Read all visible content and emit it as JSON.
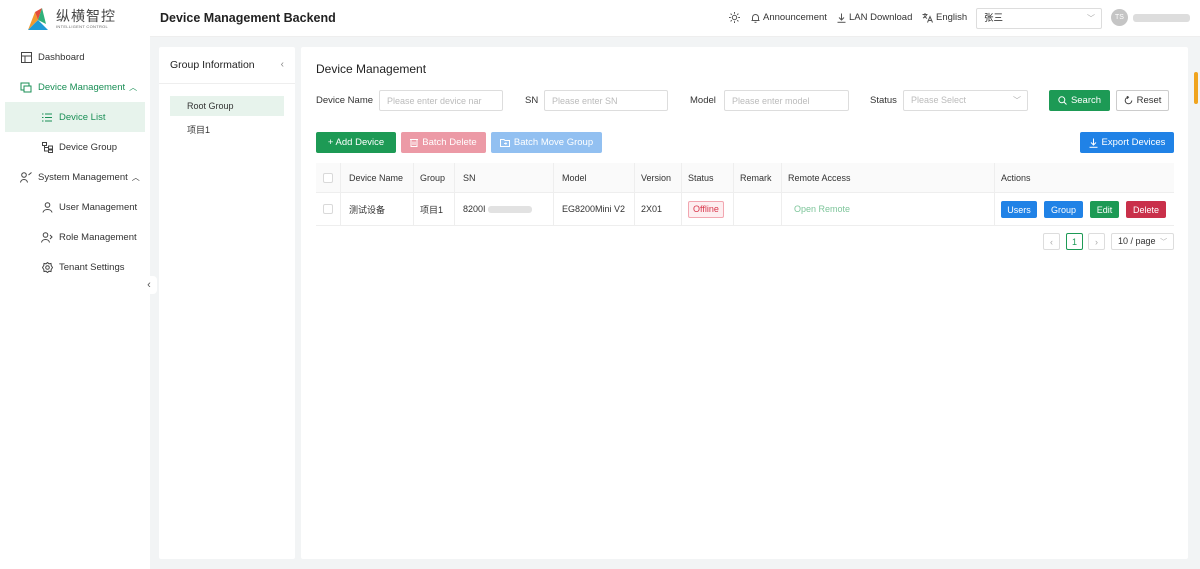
{
  "brand": {
    "name_cn": "纵横智控",
    "name_en": "INTELLIGENT CONTROL",
    "colors": {
      "primary": "#1d9a55",
      "blue": "#2082e6",
      "danger": "#d8364b"
    }
  },
  "header": {
    "title": "Device Management Backend",
    "theme_icon": "sun-icon",
    "announcement": "Announcement",
    "lan_download": "LAN Download",
    "language": "English",
    "tenant_user": "张三",
    "avatar_initials": "TS"
  },
  "sidebar": {
    "items": [
      {
        "label": "Dashboard",
        "icon": "dashboard-icon"
      },
      {
        "label": "Device Management",
        "icon": "device-icon"
      },
      {
        "label": "Device List",
        "icon": "list-icon"
      },
      {
        "label": "Device Group",
        "icon": "tree-icon"
      },
      {
        "label": "System Management",
        "icon": "system-icon"
      },
      {
        "label": "User Management",
        "icon": "user-icon"
      },
      {
        "label": "Role Management",
        "icon": "role-icon"
      },
      {
        "label": "Tenant Settings",
        "icon": "gear-icon"
      }
    ]
  },
  "group_panel": {
    "title": "Group Information",
    "tree": [
      "Root Group",
      "项目1"
    ]
  },
  "main": {
    "title": "Device Management",
    "filters": {
      "device_name_label": "Device Name",
      "device_name_placeholder": "Please enter device nar",
      "sn_label": "SN",
      "sn_placeholder": "Please enter SN",
      "model_label": "Model",
      "model_placeholder": "Please enter model",
      "status_label": "Status",
      "status_placeholder": "Please Select",
      "search": "Search",
      "reset": "Reset"
    },
    "toolbar": {
      "add": "+ Add Device",
      "batch_delete": "Batch Delete",
      "batch_move": "Batch Move Group",
      "export": "Export Devices"
    },
    "table": {
      "columns": [
        "Device Name",
        "Group",
        "SN",
        "Model",
        "Version",
        "Status",
        "Remark",
        "Remote Access",
        "Actions"
      ],
      "rows": [
        {
          "device_name": "测试设备",
          "group": "项目1",
          "sn_prefix": "8200I",
          "model": "EG8200Mini V2",
          "version": "2X01",
          "status": "Offline",
          "remark": "",
          "remote_access": "Open Remote",
          "actions": [
            "Users",
            "Group",
            "Edit",
            "Delete"
          ]
        }
      ]
    },
    "pagination": {
      "current_page": "1",
      "page_size": "10 / page"
    }
  }
}
